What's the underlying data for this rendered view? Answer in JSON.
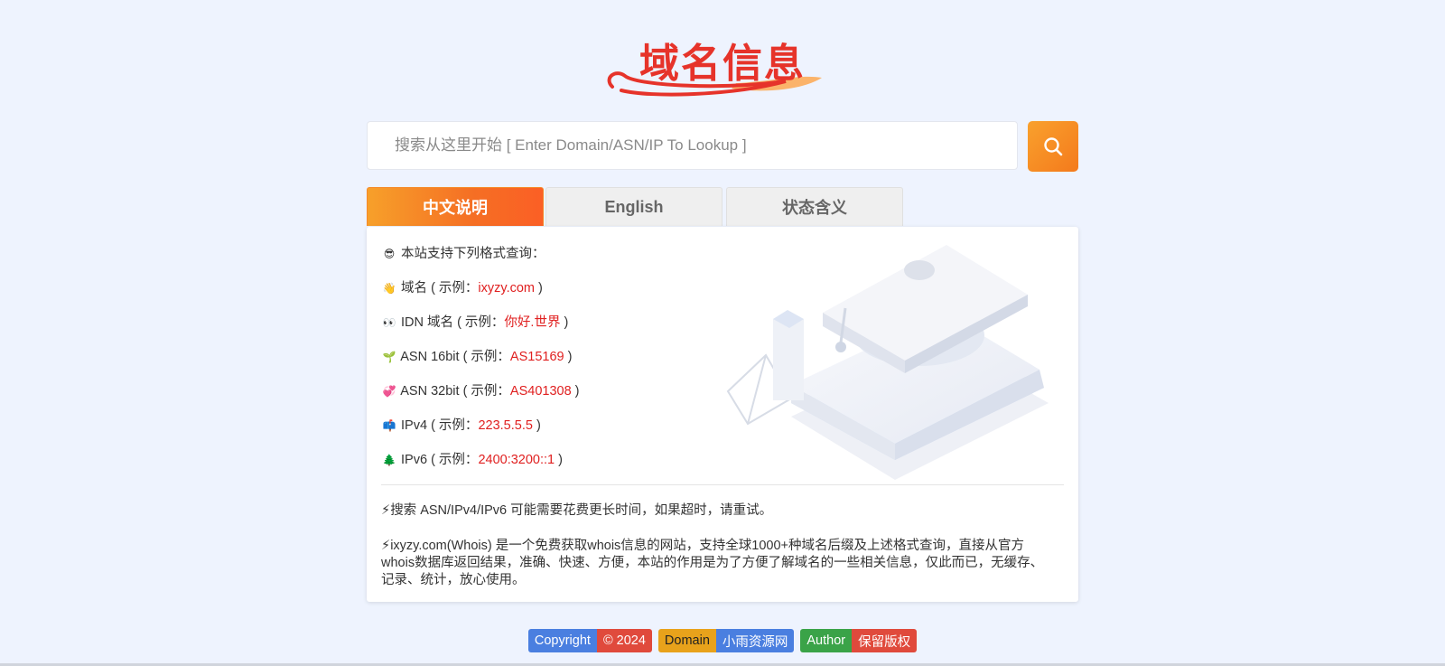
{
  "logo": {
    "text": "域名信息"
  },
  "search": {
    "placeholder": "搜索从这里开始 [ Enter Domain/ASN/IP To Lookup ]",
    "button_icon": "search-icon"
  },
  "tabs": [
    {
      "label": "中文说明",
      "active": true
    },
    {
      "label": "English",
      "active": false
    },
    {
      "label": "状态含义",
      "active": false
    }
  ],
  "intro": {
    "icon": "😎",
    "text": "本站支持下列格式查询："
  },
  "formats": [
    {
      "icon": "👋",
      "label": "域名",
      "prefix": "( 示例：",
      "example": "ixyzy.com",
      "suffix": " )"
    },
    {
      "icon": "👀",
      "label": "IDN 域名",
      "prefix": "( 示例：",
      "example": "你好.世界",
      "suffix": " )"
    },
    {
      "icon": "🌱",
      "label": "ASN 16bit",
      "prefix": "( 示例：",
      "example": "AS15169",
      "suffix": " )"
    },
    {
      "icon": "💞",
      "label": "ASN 32bit",
      "prefix": "( 示例：",
      "example": "AS401308",
      "suffix": " )"
    },
    {
      "icon": "📫",
      "label": "IPv4",
      "prefix": "( 示例：",
      "example": "223.5.5.5",
      "suffix": " )"
    },
    {
      "icon": "🌲",
      "label": "IPv6",
      "prefix": "( 示例：",
      "example": "2400:3200::1",
      "suffix": " )"
    }
  ],
  "notes": [
    {
      "icon": "⚡",
      "text": "搜索 ASN/IPv4/IPv6 可能需要花费更长时间，如果超时，请重试。"
    },
    {
      "icon": "⚡",
      "text": "ixyzy.com(Whois) 是一个免费获取whois信息的网站，支持全球1000+种域名后缀及上述格式查询，直接从官方whois数据库返回结果，准确、快速、方便，本站的作用是为了方便了解域名的一些相关信息，仅此而已，无缓存、记录、统计，放心使用。"
    }
  ],
  "footer": [
    {
      "left": "Copyright",
      "right": "© 2024",
      "left_color": "#4a7fe0",
      "right_color": "#e04a3c"
    },
    {
      "left": "Domain",
      "right": "小雨资源网",
      "left_color": "#e8a21b",
      "right_color": "#4a7fe0"
    },
    {
      "left": "Author",
      "right": "保留版权",
      "left_color": "#3aa348",
      "right_color": "#e04a3c"
    }
  ]
}
